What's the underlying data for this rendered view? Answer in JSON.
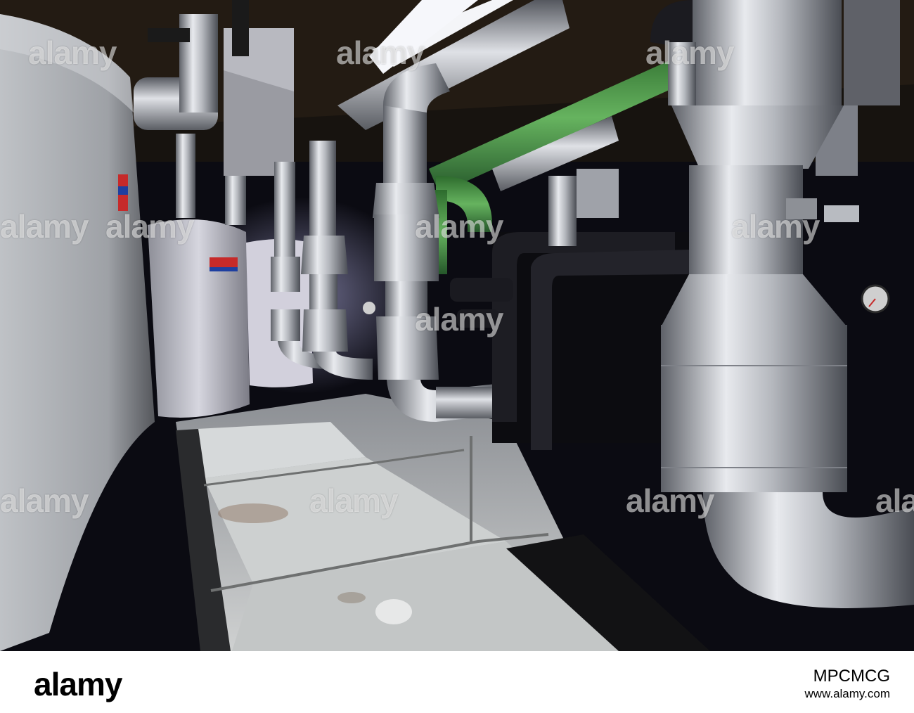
{
  "image": {
    "description_tag": "industrial-plant-room-photo",
    "colors": {
      "background_dark": "#0b0b12",
      "pipe_aluminium": "#b9bcc4",
      "floor_grey": "#c9cbcb",
      "green_pipe": "#3e8a3c",
      "tank_silver": "#a6a9ad"
    }
  },
  "watermarks": [
    "alamy",
    "alamy",
    "alamy",
    "alamy",
    "alamy",
    "alamy",
    "alamy",
    "alamy",
    "alamy",
    "alamy",
    "alamy",
    "alamy"
  ],
  "footer": {
    "logo_text": "alamy",
    "url_text": "www.alamy.com",
    "image_id": "MPCMCG"
  }
}
